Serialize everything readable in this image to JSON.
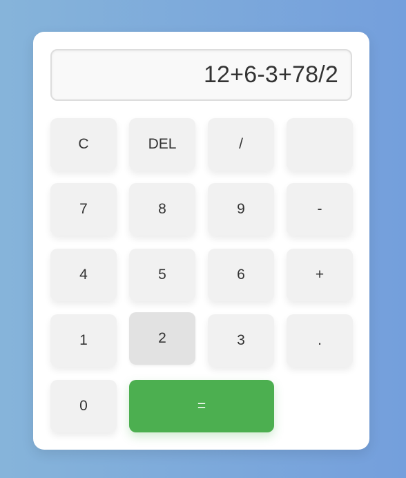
{
  "display": {
    "expression": "12+6-3+78/2"
  },
  "keys": {
    "clear": "C",
    "delete": "DEL",
    "divide": "/",
    "blank": "",
    "seven": "7",
    "eight": "8",
    "nine": "9",
    "minus": "-",
    "four": "4",
    "five": "5",
    "six": "6",
    "plus": "+",
    "one": "1",
    "two": "2",
    "three": "3",
    "decimal": ".",
    "zero": "0",
    "equals": "="
  },
  "state": {
    "pressed_key": "2"
  },
  "colors": {
    "background_start": "#86b4da",
    "background_end": "#749fdc",
    "panel": "#ffffff",
    "key": "#f1f1f1",
    "key_pressed": "#e2e2e2",
    "equals": "#4caf50",
    "text": "#333333"
  }
}
